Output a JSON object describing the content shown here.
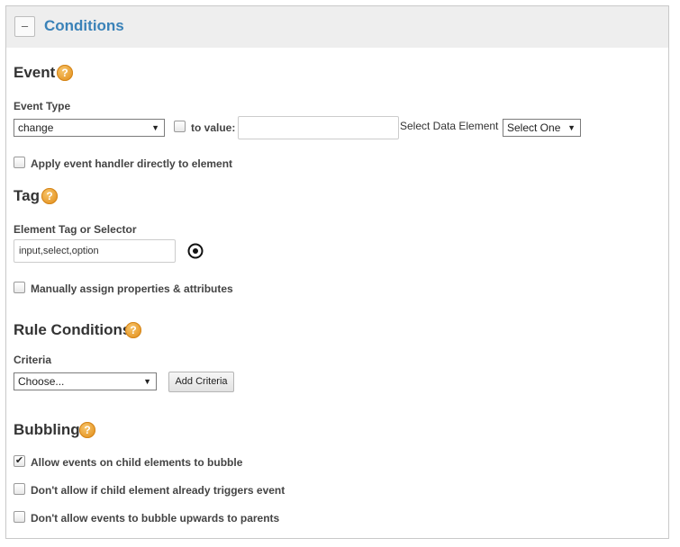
{
  "panel": {
    "collapse_symbol": "–",
    "title": "Conditions"
  },
  "event": {
    "heading": "Event",
    "help": "?",
    "event_type_label": "Event Type",
    "event_type_value": "change",
    "to_value_label": "to value:",
    "to_value_input": "",
    "data_element_label": "Select Data Element",
    "data_element_value": "Select One",
    "apply_handler_label": "Apply event handler directly to element"
  },
  "tag": {
    "heading": "Tag",
    "help": "?",
    "selector_label": "Element Tag or Selector",
    "selector_value": "input,select,option",
    "manual_assign_label": "Manually assign properties & attributes"
  },
  "rule_conditions": {
    "heading": "Rule Conditions",
    "help": "?",
    "criteria_label": "Criteria",
    "criteria_value": "Choose...",
    "add_criteria_button": "Add Criteria"
  },
  "bubbling": {
    "heading": "Bubbling",
    "help": "?",
    "options": [
      {
        "label": "Allow events on child elements to bubble",
        "checked": true
      },
      {
        "label": "Don't allow if child element already triggers event",
        "checked": false
      },
      {
        "label": "Don't allow events to bubble upwards to parents",
        "checked": false
      }
    ]
  },
  "icons": {
    "help": "question-circle-icon",
    "target": "target-selector-icon",
    "caret": "caret-down-icon",
    "check": "✔"
  },
  "colors": {
    "title_blue": "#3a82b8",
    "help_orange": "#e79a2b",
    "header_bg": "#eeeeee"
  }
}
